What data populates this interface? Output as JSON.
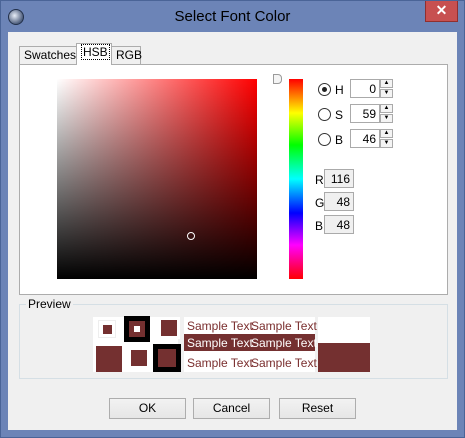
{
  "window": {
    "title": "Select Font Color",
    "close_glyph": "✕"
  },
  "tabs": [
    {
      "label": "Swatches"
    },
    {
      "label": "HSB"
    },
    {
      "label": "RGB"
    }
  ],
  "hsb": {
    "h": {
      "label": "H",
      "value": "0",
      "selected": true
    },
    "s": {
      "label": "S",
      "value": "59",
      "selected": false
    },
    "b": {
      "label": "B",
      "value": "46",
      "selected": false
    }
  },
  "rgb": {
    "r": {
      "label": "R",
      "value": "116"
    },
    "g": {
      "label": "G",
      "value": "48"
    },
    "b": {
      "label": "B",
      "value": "48"
    }
  },
  "colors": {
    "selected": "#743030",
    "hue_base": "#ff0000"
  },
  "preview": {
    "label": "Preview",
    "samples": [
      "Sample Text",
      "Sample Text",
      "Sample Text",
      "Sample Text",
      "Sample Text",
      "Sample Text"
    ]
  },
  "buttons": {
    "ok": "OK",
    "cancel": "Cancel",
    "reset": "Reset"
  }
}
